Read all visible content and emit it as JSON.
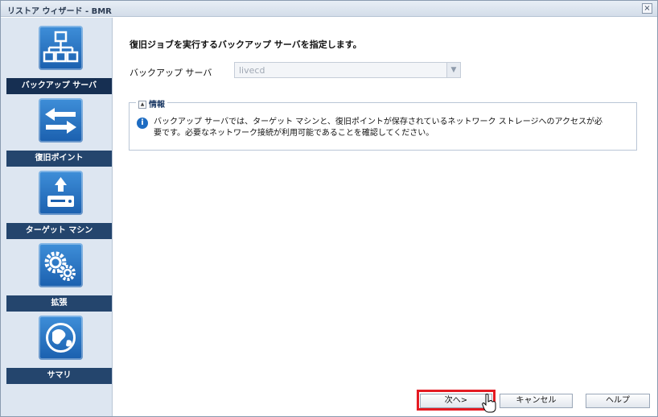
{
  "window": {
    "title": "リストア ウィザード - BMR",
    "close_glyph": "×"
  },
  "sidebar": {
    "steps": [
      {
        "label": "バックアップ サーバ",
        "icon": "network-tree-icon",
        "active": true
      },
      {
        "label": "復旧ポイント",
        "icon": "transfer-arrows-icon"
      },
      {
        "label": "ターゲット マシン",
        "icon": "drive-icon"
      },
      {
        "label": "拡張",
        "icon": "gears-icon"
      },
      {
        "label": "サマリ",
        "icon": "globe-icon"
      }
    ]
  },
  "main": {
    "instruction": "復旧ジョブを実行するバックアップ サーバを指定します。",
    "server_field": {
      "label": "バックアップ サーバ",
      "value": "livecd"
    },
    "info": {
      "title": "情報",
      "text": "バックアップ サーバでは、ターゲット マシンと、復旧ポイントが保存されているネットワーク ストレージへのアクセスが必要です。必要なネットワーク接続が利用可能であることを確認してください。"
    }
  },
  "buttons": {
    "next": "次へ>",
    "cancel": "キャンセル",
    "help": "ヘルプ"
  },
  "colors": {
    "accent": "#24456d",
    "highlight": "#e41b23",
    "icon_blue": "#1a5fae"
  }
}
